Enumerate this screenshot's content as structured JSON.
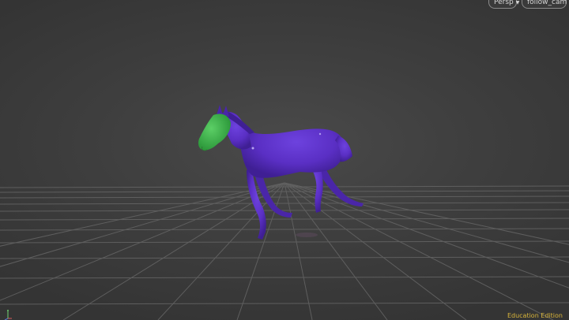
{
  "toolbar": {
    "view_mode": "Persp",
    "camera": "follow_cam"
  },
  "status": {
    "edition": "Education Edition"
  },
  "icons": {
    "dropdown": "chevron-down-icon",
    "axis": "axis-gizmo-icon"
  },
  "colors": {
    "background": "#3f3f3f",
    "grid": "#6a6a6a",
    "model": "#5a2fc4",
    "selection": "#3bb54a",
    "edition_text": "#d9b53a"
  }
}
